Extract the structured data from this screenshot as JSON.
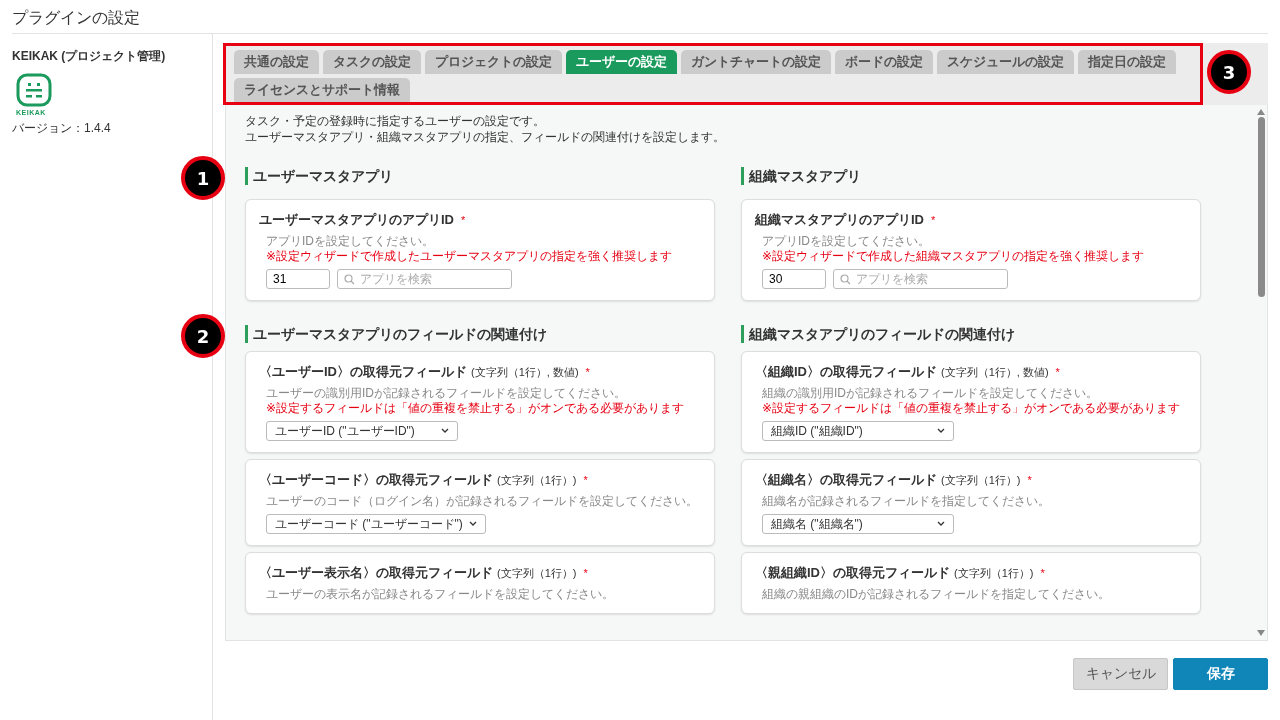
{
  "page_title": "プラグインの設定",
  "sidebar": {
    "plugin_name": "KEIKAK (プロジェクト管理)",
    "logo_text": "KEIKAK",
    "version": "バージョン：1.4.4"
  },
  "tabs": {
    "callout": "3",
    "items": [
      {
        "label": "共通の設定",
        "selected": false
      },
      {
        "label": "タスクの設定",
        "selected": false
      },
      {
        "label": "プロジェクトの設定",
        "selected": false
      },
      {
        "label": "ユーザーの設定",
        "selected": true
      },
      {
        "label": "ガントチャートの設定",
        "selected": false
      },
      {
        "label": "ボードの設定",
        "selected": false
      },
      {
        "label": "スケジュールの設定",
        "selected": false
      },
      {
        "label": "指定日の設定",
        "selected": false
      },
      {
        "label": "ライセンスとサポート情報",
        "selected": false
      }
    ]
  },
  "description": [
    "タスク・予定の登録時に指定するユーザーの設定です。",
    "ユーザーマスタアプリ・組織マスタアプリの指定、フィールドの関連付けを設定します。"
  ],
  "columns": [
    {
      "app_section": {
        "callout": "1",
        "title": "ユーザーマスタアプリ",
        "label": "ユーザーマスタアプリのアプリID",
        "required": "*",
        "hint": "アプリIDを設定してください。",
        "warning": "※設定ウィザードで作成したユーザーマスタアプリの指定を強く推奨します",
        "app_id": "31",
        "search_placeholder": "アプリを検索"
      },
      "field_section": {
        "callout": "2",
        "title": "ユーザーマスタアプリのフィールドの関連付け",
        "fields": [
          {
            "label": "〈ユーザーID〉の取得元フィールド",
            "types": "(文字列（1行）, 数値)",
            "required": "*",
            "hint": "ユーザーの識別用IDが記録されるフィールドを設定してください。",
            "warning": "※設定するフィールドは「値の重複を禁止する」がオンである必要があります",
            "value": "ユーザーID (\"ユーザーID\")"
          },
          {
            "label": "〈ユーザーコード〉の取得元フィールド",
            "types": "(文字列（1行）)",
            "required": "*",
            "hint": "ユーザーのコード（ログイン名）が記録されるフィールドを設定してください。",
            "value": "ユーザーコード (\"ユーザーコード\")"
          },
          {
            "label": "〈ユーザー表示名〉の取得元フィールド",
            "types": "(文字列（1行）)",
            "required": "*",
            "hint": "ユーザーの表示名が記録されるフィールドを設定してください。"
          }
        ]
      }
    },
    {
      "app_section": {
        "title": "組織マスタアプリ",
        "label": "組織マスタアプリのアプリID",
        "required": "*",
        "hint": "アプリIDを設定してください。",
        "warning": "※設定ウィザードで作成した組織マスタアプリの指定を強く推奨します",
        "app_id": "30",
        "search_placeholder": "アプリを検索"
      },
      "field_section": {
        "title": "組織マスタアプリのフィールドの関連付け",
        "fields": [
          {
            "label": "〈組織ID〉の取得元フィールド",
            "types": "(文字列（1行）, 数値)",
            "required": "*",
            "hint": "組織の識別用IDが記録されるフィールドを設定してください。",
            "warning": "※設定するフィールドは「値の重複を禁止する」がオンである必要があります",
            "value": "組織ID (\"組織ID\")"
          },
          {
            "label": "〈組織名〉の取得元フィールド",
            "types": "(文字列（1行）)",
            "required": "*",
            "hint": "組織名が記録されるフィールドを指定してください。",
            "value": "組織名 (\"組織名\")"
          },
          {
            "label": "〈親組織ID〉の取得元フィールド",
            "types": "(文字列（1行）)",
            "required": "*",
            "hint": "組織の親組織のIDが記録されるフィールドを指定してください。"
          }
        ]
      }
    }
  ],
  "buttons": [
    {
      "label": "キャンセル",
      "kind": "secondary"
    },
    {
      "label": "保存",
      "kind": "primary"
    }
  ]
}
